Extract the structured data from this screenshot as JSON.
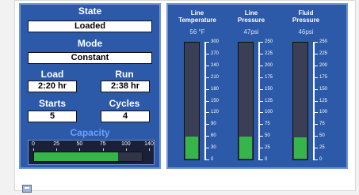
{
  "left_panel": {
    "state": {
      "label": "State",
      "value": "Loaded"
    },
    "mode": {
      "label": "Mode",
      "value": "Constant"
    },
    "load": {
      "label": "Load",
      "value": "2:20 hr"
    },
    "run": {
      "label": "Run",
      "value": "2:38 hr"
    },
    "starts": {
      "label": "Starts",
      "value": "5"
    },
    "cycles": {
      "label": "Cycles",
      "value": "4"
    },
    "capacity": {
      "label": "Capacity",
      "ticks": [
        "0",
        "25",
        "50",
        "75",
        "100",
        "140"
      ],
      "fill_fraction": 0.78
    }
  },
  "gauges": [
    {
      "title_line1": "Line",
      "title_line2": "Temperature",
      "reading": "56 °F",
      "fill_fraction": 0.19,
      "ticks": [
        "300",
        "270",
        "240",
        "210",
        "180",
        "150",
        "120",
        "90",
        "60",
        "30",
        "0"
      ]
    },
    {
      "title_line1": "Line",
      "title_line2": "Pressure",
      "reading": "47psi",
      "fill_fraction": 0.19,
      "ticks": [
        "250",
        "225",
        "200",
        "175",
        "150",
        "125",
        "100",
        "75",
        "50",
        "25",
        "0"
      ]
    },
    {
      "title_line1": "Fluid",
      "title_line2": "Pressure",
      "reading": "46psi",
      "fill_fraction": 0.18,
      "ticks": [
        "250",
        "225",
        "200",
        "175",
        "150",
        "125",
        "100",
        "75",
        "50",
        "25",
        "0"
      ]
    }
  ],
  "colors": {
    "panel": "#2c5aa8",
    "fill": "#35b54a",
    "label_accent": "#6aa0ff"
  },
  "icons": {
    "bottom": "save-icon"
  }
}
